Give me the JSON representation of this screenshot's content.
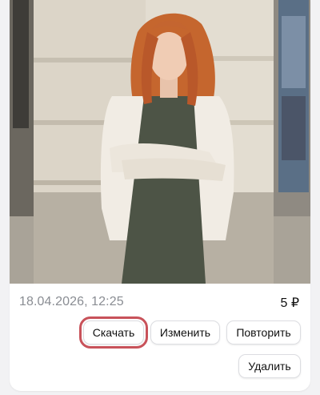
{
  "item": {
    "date": "18.04.2026, 12:25",
    "price": "5 ₽"
  },
  "actions": {
    "download_label": "Скачать",
    "edit_label": "Изменить",
    "repeat_label": "Повторить",
    "delete_label": "Удалить"
  },
  "colors": {
    "highlight_outline": "#c8525a",
    "date_text": "#8a8d93",
    "page_bg": "#f2f2f4"
  }
}
